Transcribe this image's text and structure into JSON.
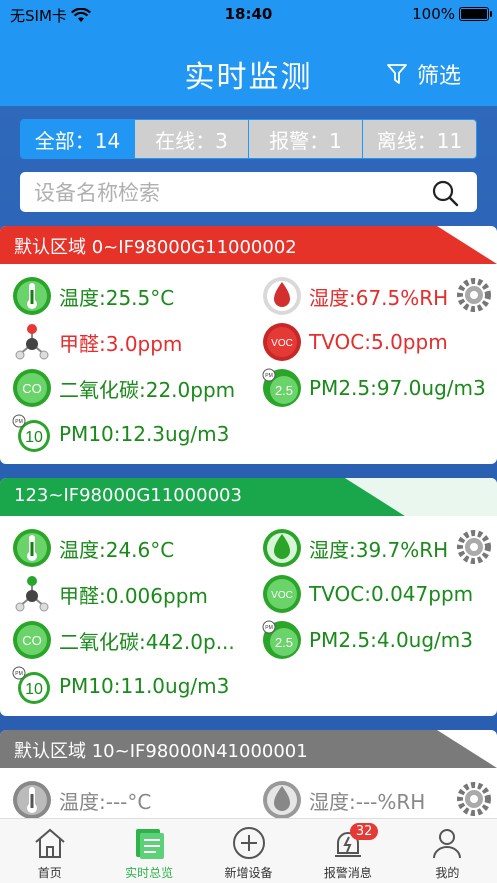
{
  "status": {
    "carrier": "无SIM卡",
    "time": "18:40",
    "battery": "100%"
  },
  "nav": {
    "title": "实时监测",
    "filter_label": "筛选"
  },
  "segments": [
    {
      "label": "全部：14",
      "active": true
    },
    {
      "label": "在线：3",
      "active": false
    },
    {
      "label": "报警：1",
      "active": false
    },
    {
      "label": "离线：11",
      "active": false
    }
  ],
  "search": {
    "placeholder": "设备名称检索"
  },
  "devices": [
    {
      "title": "默认区域 0~IF98000G11000002",
      "state": "alarm",
      "temp": "温度:25.5°C",
      "humidity": "湿度:67.5%RH",
      "formaldehyde": "甲醛:3.0ppm",
      "tvoc": "TVOC:5.0ppm",
      "co2": "二氧化碳:22.0ppm",
      "pm25": "PM2.5:97.0ug/m3",
      "pm10": "PM10:12.3ug/m3"
    },
    {
      "title": "123~IF98000G11000003",
      "state": "online",
      "temp": "温度:24.6°C",
      "humidity": "湿度:39.7%RH",
      "formaldehyde": "甲醛:0.006ppm",
      "tvoc": "TVOC:0.047ppm",
      "co2": "二氧化碳:442.0p...",
      "pm25": "PM2.5:4.0ug/m3",
      "pm10": "PM10:11.0ug/m3"
    },
    {
      "title": "默认区域 10~IF98000N41000001",
      "state": "offline",
      "temp": "温度:---°C",
      "humidity": "湿度:---%RH"
    }
  ],
  "tabs": [
    {
      "label": "首页",
      "icon": "home-icon"
    },
    {
      "label": "实时总览",
      "icon": "overview-icon",
      "active": true
    },
    {
      "label": "新增设备",
      "icon": "add-device-icon"
    },
    {
      "label": "报警消息",
      "icon": "alarm-icon",
      "badge": "32"
    },
    {
      "label": "我的",
      "icon": "profile-icon"
    }
  ],
  "colors": {
    "primary": "#2196f3",
    "alarm": "#e52d2d",
    "online": "#1aa64a",
    "offline": "#7a7a7a",
    "active_tab": "#2db34a"
  }
}
